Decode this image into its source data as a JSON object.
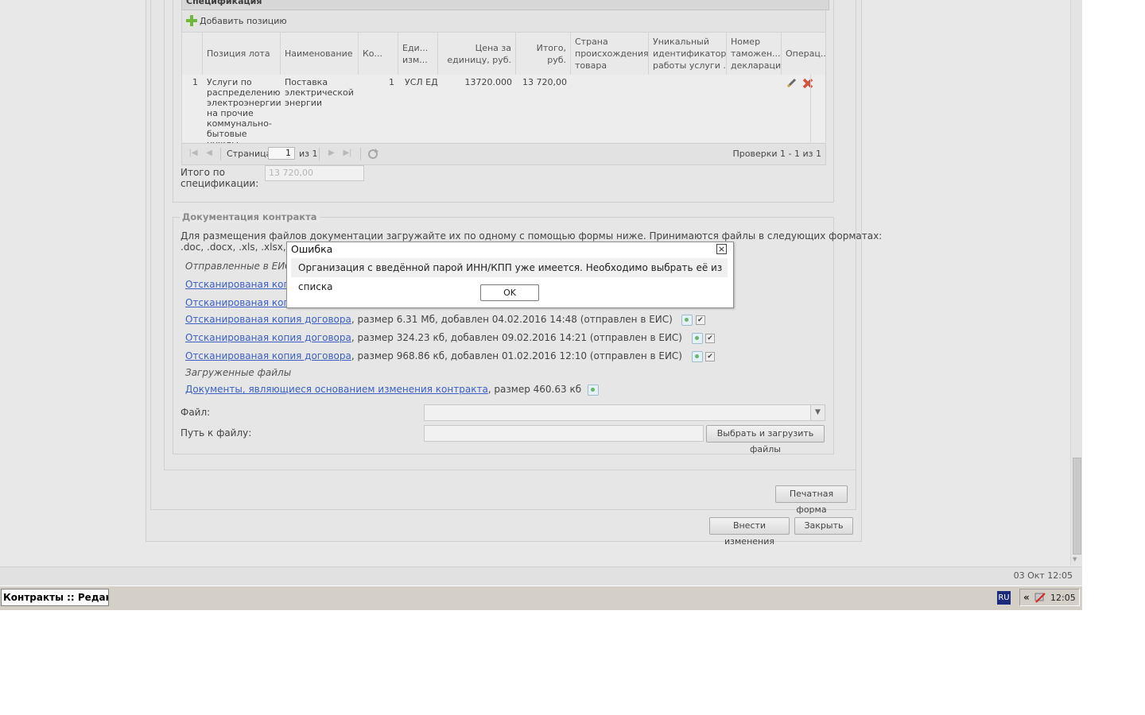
{
  "spec": {
    "title": "Спецификация",
    "add_label": "Добавить позицию",
    "columns": [
      "Позиция лота",
      "Наименование",
      "Ко...",
      "Еди... изм...",
      "Цена за единицу, руб.",
      "Итого, руб.",
      "Страна происхождения товара",
      "Уникальный идентификатор... работы услуги ...",
      "Номер таможен... декларации",
      "Операц..."
    ],
    "row": {
      "num": "1",
      "position": "Услуги по распределению электроэнергии на прочие коммунально-бытовые нужды",
      "name": "Поставка электрической энергии",
      "qty": "1",
      "unit": "УСЛ ЕД",
      "price": "13720.000",
      "total": "13 720,00"
    },
    "pager": {
      "page_label": "Страница",
      "page_value": "1",
      "of_label": "из 1",
      "summary": "Проверки 1 - 1 из 1"
    },
    "total_label": "Итого по спецификации:",
    "total_value": "13 720,00"
  },
  "docs": {
    "legend": "Документация контракта",
    "info": "Для размещения файлов документации загружайте их по одному с помощью формы ниже. Принимаются файлы в следующих форматах:",
    "formats": ".doc, .docx, .xls, .xlsx, .f",
    "sent_title": "Отправленные в ЕИС",
    "partial_link_1": "Отсканированая копия",
    "partial_link_2": "Отсканированая копия",
    "files_sent": [
      {
        "link": "Отсканированая копия договора",
        "info": ", размер 6.31 Мб, добавлен 04.02.2016 14:48 (отправлен в ЕИС)"
      },
      {
        "link": "Отсканированая копия договора",
        "info": ", размер 324.23 кб, добавлен 09.02.2016 14:21 (отправлен в ЕИС)"
      },
      {
        "link": "Отсканированая копия договора",
        "info": ", размер 968.86 кб, добавлен 01.02.2016 12:10 (отправлен в ЕИС)"
      }
    ],
    "loaded_title": "Загруженные файлы",
    "loaded_file": {
      "link": "Документы, являющиеся основанием изменения контракта",
      "info": ", размер 460.63 кб"
    },
    "file_label": "Файл:",
    "path_label": "Путь к файлу:",
    "upload_button": "Выбрать и загрузить файлы"
  },
  "buttons": {
    "print": "Печатная форма",
    "apply": "Внести изменения",
    "close": "Закрыть"
  },
  "status": {
    "datetime": "03 Окт 12:05"
  },
  "taskbar": {
    "task": "Контракты :: Редакт...",
    "lang": "RU",
    "arrows": "«",
    "time": "12:05"
  },
  "dialog": {
    "title": "Ошибка",
    "message": "Организация с введённой парой ИНН/КПП уже имеется. Необходимо выбрать её из списка",
    "ok": "OK",
    "close": "×"
  }
}
